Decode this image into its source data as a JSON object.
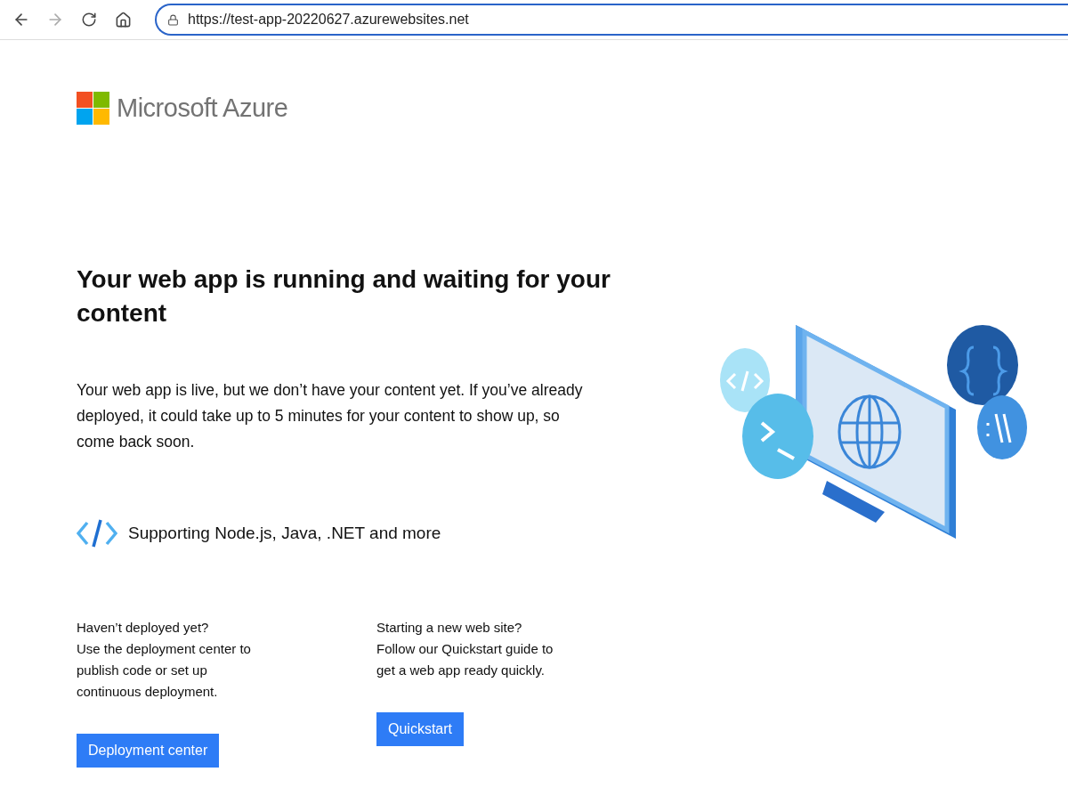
{
  "browser": {
    "url": "https://test-app-20220627.azurewebsites.net",
    "forward_disabled": true
  },
  "logo": {
    "text": "Microsoft Azure"
  },
  "heading": "Your web app is running and waiting for your content",
  "intro": "Your web app is live, but we don’t have your content yet. If you’ve already deployed, it could take up to 5 minutes for your content to show up, so come back soon.",
  "support": "Supporting Node.js, Java, .NET and more",
  "columns": [
    {
      "question": "Haven’t deployed yet?",
      "text": "Use the deployment center to publish code or set up continuous deployment.",
      "button": "Deployment center"
    },
    {
      "question": "Starting a new web site?",
      "text": "Follow our Quickstart guide to get a web app ready quickly.",
      "button": "Quickstart"
    }
  ]
}
